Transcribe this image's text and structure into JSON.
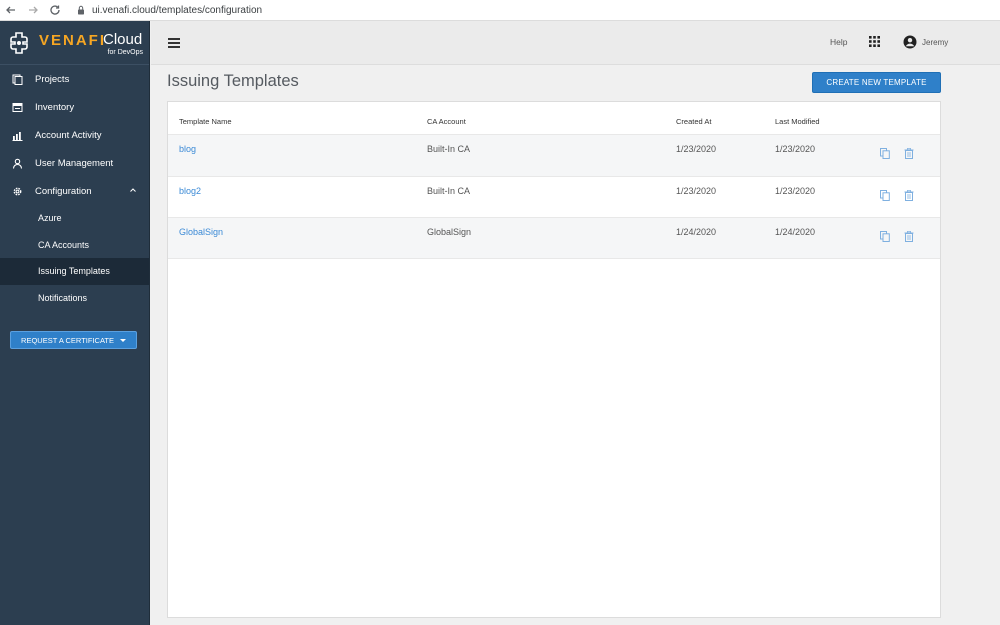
{
  "browser": {
    "url": "ui.venafi.cloud/templates/configuration"
  },
  "brand": {
    "name": "VENAFI",
    "product": "Cloud",
    "tagline": "for DevOps",
    "accent": "#f6a623"
  },
  "sidebar": {
    "items": [
      {
        "label": "Projects",
        "icon": "projects-icon"
      },
      {
        "label": "Inventory",
        "icon": "inventory-icon"
      },
      {
        "label": "Account Activity",
        "icon": "activity-chart-icon"
      },
      {
        "label": "User Management",
        "icon": "user-icon"
      },
      {
        "label": "Configuration",
        "icon": "gear-icon",
        "expanded": true
      }
    ],
    "subitems": [
      {
        "label": "Azure"
      },
      {
        "label": "CA Accounts"
      },
      {
        "label": "Issuing Templates",
        "active": true
      },
      {
        "label": "Notifications"
      }
    ],
    "request_button": "REQUEST A CERTIFICATE"
  },
  "header": {
    "help": "Help",
    "user": "Jeremy"
  },
  "main": {
    "title": "Issuing Templates",
    "create_button": "CREATE NEW TEMPLATE",
    "columns": [
      "Template Name",
      "CA Account",
      "Created At",
      "Last Modified"
    ],
    "rows": [
      {
        "name": "blog",
        "ca": "Built-In CA",
        "created": "1/23/2020",
        "modified": "1/23/2020"
      },
      {
        "name": "blog2",
        "ca": "Built-In CA",
        "created": "1/23/2020",
        "modified": "1/23/2020"
      },
      {
        "name": "GlobalSign",
        "ca": "GlobalSign",
        "created": "1/24/2020",
        "modified": "1/24/2020"
      }
    ]
  },
  "colors": {
    "sidebar_bg": "#2c3e50",
    "primary_button": "#2f80c9",
    "link": "#3b8ad6"
  }
}
